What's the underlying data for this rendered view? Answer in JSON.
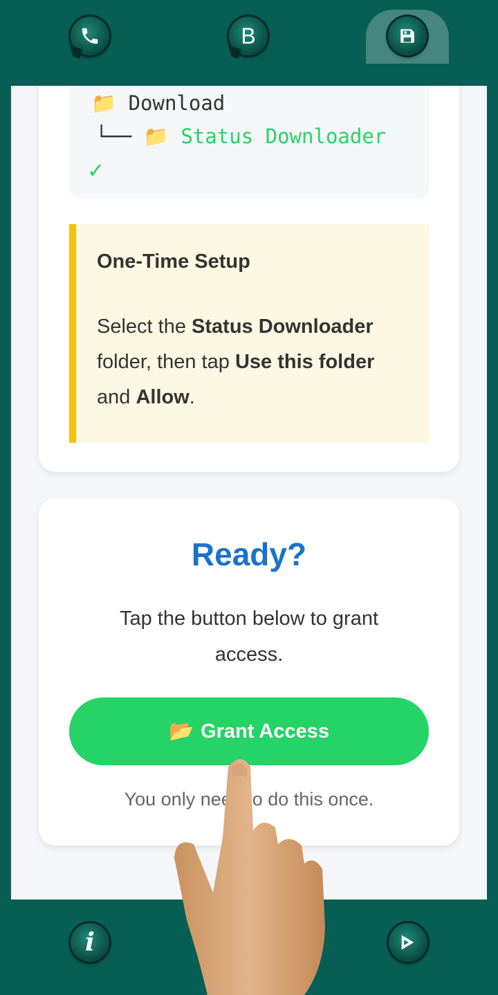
{
  "top_nav": {
    "whatsapp_icon": "phone-bubble-icon",
    "business_label": "B",
    "saved_icon": "floppy-disk-icon"
  },
  "folder_tree": {
    "root_label": "Download",
    "branch": "└──",
    "child_label": "Status Downloader",
    "check": "✓",
    "folder_glyph": "📁"
  },
  "setup_note": {
    "title": "One-Time Setup",
    "text_1": "Select the ",
    "bold_1": "Status Downloader",
    "text_2": " folder, then tap ",
    "bold_2": "Use this folder",
    "text_3": " and ",
    "bold_3": "Allow",
    "text_4": "."
  },
  "ready_card": {
    "title": "Ready?",
    "text": "Tap the button below to grant access.",
    "button_icon": "📂",
    "button_label": "Grant Access",
    "footnote": "You only need to do this once."
  },
  "bottom_nav": {
    "info_label": "i",
    "play_icon": "play-store-icon"
  },
  "colors": {
    "bar": "#075e54",
    "accent_green": "#25d366",
    "title_blue": "#1a73c8",
    "note_border": "#f7c10b"
  }
}
